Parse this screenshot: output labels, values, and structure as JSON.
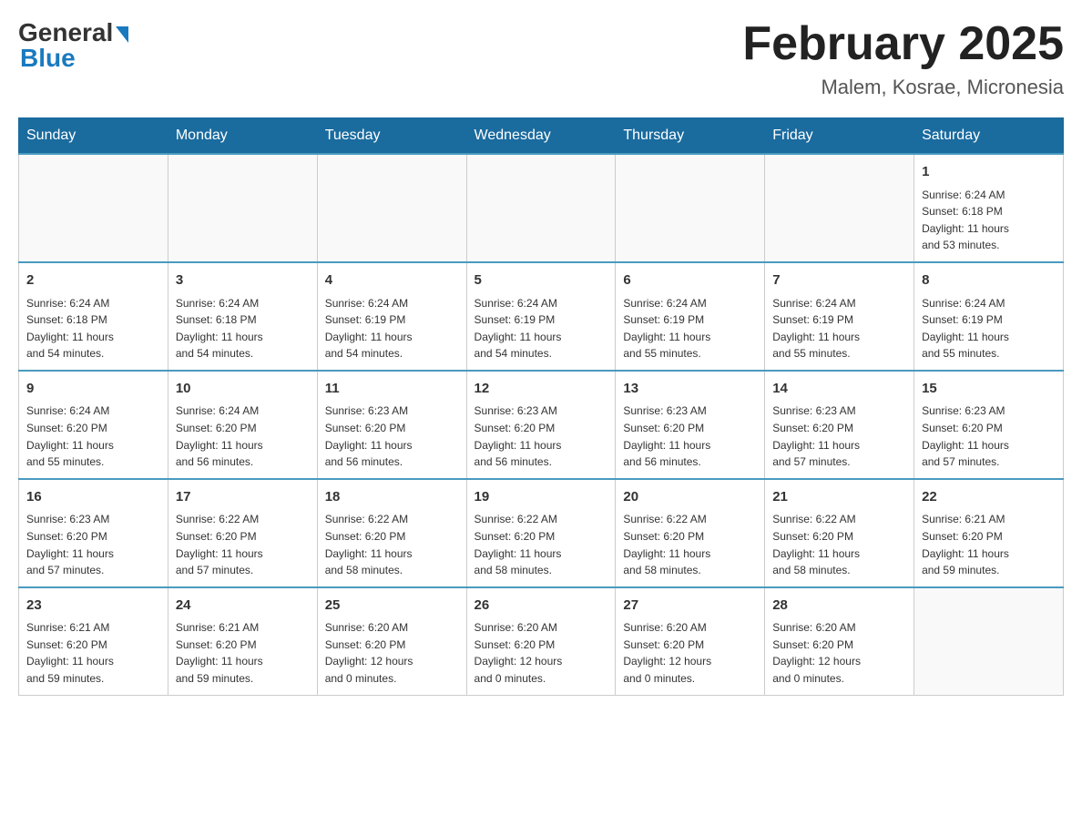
{
  "header": {
    "logo_general": "General",
    "logo_blue": "Blue",
    "title": "February 2025",
    "subtitle": "Malem, Kosrae, Micronesia"
  },
  "weekdays": [
    "Sunday",
    "Monday",
    "Tuesday",
    "Wednesday",
    "Thursday",
    "Friday",
    "Saturday"
  ],
  "weeks": [
    {
      "days": [
        {
          "num": "",
          "info": ""
        },
        {
          "num": "",
          "info": ""
        },
        {
          "num": "",
          "info": ""
        },
        {
          "num": "",
          "info": ""
        },
        {
          "num": "",
          "info": ""
        },
        {
          "num": "",
          "info": ""
        },
        {
          "num": "1",
          "info": "Sunrise: 6:24 AM\nSunset: 6:18 PM\nDaylight: 11 hours\nand 53 minutes."
        }
      ]
    },
    {
      "days": [
        {
          "num": "2",
          "info": "Sunrise: 6:24 AM\nSunset: 6:18 PM\nDaylight: 11 hours\nand 54 minutes."
        },
        {
          "num": "3",
          "info": "Sunrise: 6:24 AM\nSunset: 6:18 PM\nDaylight: 11 hours\nand 54 minutes."
        },
        {
          "num": "4",
          "info": "Sunrise: 6:24 AM\nSunset: 6:19 PM\nDaylight: 11 hours\nand 54 minutes."
        },
        {
          "num": "5",
          "info": "Sunrise: 6:24 AM\nSunset: 6:19 PM\nDaylight: 11 hours\nand 54 minutes."
        },
        {
          "num": "6",
          "info": "Sunrise: 6:24 AM\nSunset: 6:19 PM\nDaylight: 11 hours\nand 55 minutes."
        },
        {
          "num": "7",
          "info": "Sunrise: 6:24 AM\nSunset: 6:19 PM\nDaylight: 11 hours\nand 55 minutes."
        },
        {
          "num": "8",
          "info": "Sunrise: 6:24 AM\nSunset: 6:19 PM\nDaylight: 11 hours\nand 55 minutes."
        }
      ]
    },
    {
      "days": [
        {
          "num": "9",
          "info": "Sunrise: 6:24 AM\nSunset: 6:20 PM\nDaylight: 11 hours\nand 55 minutes."
        },
        {
          "num": "10",
          "info": "Sunrise: 6:24 AM\nSunset: 6:20 PM\nDaylight: 11 hours\nand 56 minutes."
        },
        {
          "num": "11",
          "info": "Sunrise: 6:23 AM\nSunset: 6:20 PM\nDaylight: 11 hours\nand 56 minutes."
        },
        {
          "num": "12",
          "info": "Sunrise: 6:23 AM\nSunset: 6:20 PM\nDaylight: 11 hours\nand 56 minutes."
        },
        {
          "num": "13",
          "info": "Sunrise: 6:23 AM\nSunset: 6:20 PM\nDaylight: 11 hours\nand 56 minutes."
        },
        {
          "num": "14",
          "info": "Sunrise: 6:23 AM\nSunset: 6:20 PM\nDaylight: 11 hours\nand 57 minutes."
        },
        {
          "num": "15",
          "info": "Sunrise: 6:23 AM\nSunset: 6:20 PM\nDaylight: 11 hours\nand 57 minutes."
        }
      ]
    },
    {
      "days": [
        {
          "num": "16",
          "info": "Sunrise: 6:23 AM\nSunset: 6:20 PM\nDaylight: 11 hours\nand 57 minutes."
        },
        {
          "num": "17",
          "info": "Sunrise: 6:22 AM\nSunset: 6:20 PM\nDaylight: 11 hours\nand 57 minutes."
        },
        {
          "num": "18",
          "info": "Sunrise: 6:22 AM\nSunset: 6:20 PM\nDaylight: 11 hours\nand 58 minutes."
        },
        {
          "num": "19",
          "info": "Sunrise: 6:22 AM\nSunset: 6:20 PM\nDaylight: 11 hours\nand 58 minutes."
        },
        {
          "num": "20",
          "info": "Sunrise: 6:22 AM\nSunset: 6:20 PM\nDaylight: 11 hours\nand 58 minutes."
        },
        {
          "num": "21",
          "info": "Sunrise: 6:22 AM\nSunset: 6:20 PM\nDaylight: 11 hours\nand 58 minutes."
        },
        {
          "num": "22",
          "info": "Sunrise: 6:21 AM\nSunset: 6:20 PM\nDaylight: 11 hours\nand 59 minutes."
        }
      ]
    },
    {
      "days": [
        {
          "num": "23",
          "info": "Sunrise: 6:21 AM\nSunset: 6:20 PM\nDaylight: 11 hours\nand 59 minutes."
        },
        {
          "num": "24",
          "info": "Sunrise: 6:21 AM\nSunset: 6:20 PM\nDaylight: 11 hours\nand 59 minutes."
        },
        {
          "num": "25",
          "info": "Sunrise: 6:20 AM\nSunset: 6:20 PM\nDaylight: 12 hours\nand 0 minutes."
        },
        {
          "num": "26",
          "info": "Sunrise: 6:20 AM\nSunset: 6:20 PM\nDaylight: 12 hours\nand 0 minutes."
        },
        {
          "num": "27",
          "info": "Sunrise: 6:20 AM\nSunset: 6:20 PM\nDaylight: 12 hours\nand 0 minutes."
        },
        {
          "num": "28",
          "info": "Sunrise: 6:20 AM\nSunset: 6:20 PM\nDaylight: 12 hours\nand 0 minutes."
        },
        {
          "num": "",
          "info": ""
        }
      ]
    }
  ]
}
